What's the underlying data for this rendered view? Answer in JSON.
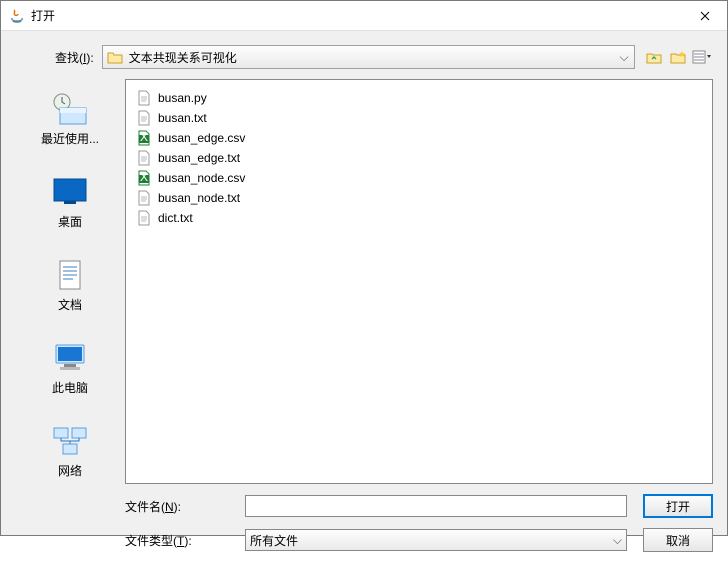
{
  "title": "打开",
  "look_in": {
    "label_pre": "查找(",
    "label_u": "I",
    "label_post": "):",
    "value": "文本共现关系可视化"
  },
  "toolbar": {
    "up_icon": "up-folder-icon",
    "new_icon": "new-folder-icon",
    "view_icon": "view-menu-icon"
  },
  "sidebar": [
    {
      "id": "recent",
      "label": "最近使用..."
    },
    {
      "id": "desktop",
      "label": "桌面"
    },
    {
      "id": "documents",
      "label": "文档"
    },
    {
      "id": "computer",
      "label": "此电脑"
    },
    {
      "id": "network",
      "label": "网络"
    }
  ],
  "files": [
    {
      "name": "busan.py",
      "type": "txt"
    },
    {
      "name": "busan.txt",
      "type": "txt"
    },
    {
      "name": "busan_edge.csv",
      "type": "csv"
    },
    {
      "name": "busan_edge.txt",
      "type": "txt"
    },
    {
      "name": "busan_node.csv",
      "type": "csv"
    },
    {
      "name": "busan_node.txt",
      "type": "txt"
    },
    {
      "name": "dict.txt",
      "type": "txt"
    }
  ],
  "filename": {
    "label_pre": "文件名(",
    "label_u": "N",
    "label_post": "):",
    "value": ""
  },
  "filetype": {
    "label_pre": "文件类型(",
    "label_u": "T",
    "label_post": "):",
    "value": "所有文件"
  },
  "buttons": {
    "open": "打开",
    "cancel": "取消"
  }
}
